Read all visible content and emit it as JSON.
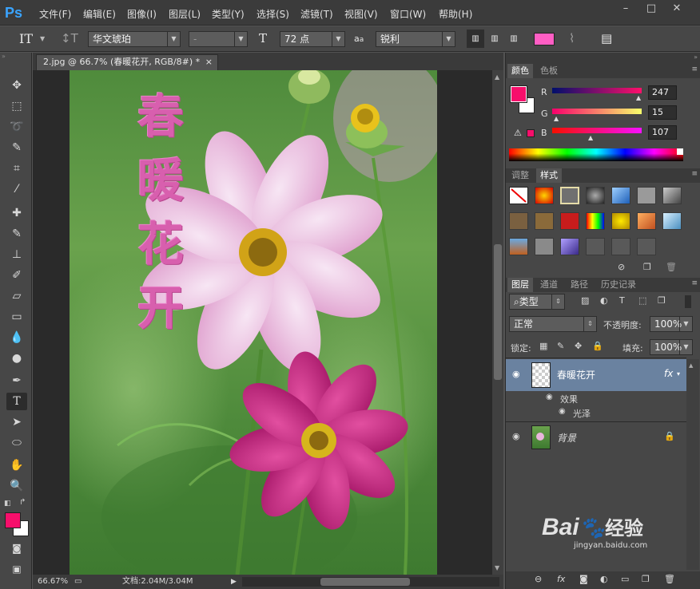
{
  "menubar": {
    "app_logo": "Ps",
    "items": [
      "文件(F)",
      "编辑(E)",
      "图像(I)",
      "图层(L)",
      "类型(Y)",
      "选择(S)",
      "滤镜(T)",
      "视图(V)",
      "窗口(W)",
      "帮助(H)"
    ]
  },
  "options": {
    "tool_glyph": "T",
    "font_family": "华文琥珀",
    "font_style": "-",
    "font_size": "72 点",
    "aa_label": "a",
    "antialias": "锐利",
    "text_color": "#ff5ec4"
  },
  "document": {
    "tab_title": "2.jpg @ 66.7% (春暖花开, RGB/8#) *",
    "close_glyph": "×",
    "text_chars": [
      "春",
      "暖",
      "花",
      "开"
    ],
    "text_color": "#d85fae"
  },
  "status": {
    "zoom": "66.67%",
    "doc_size": "文档:2.04M/3.04M"
  },
  "color_panel": {
    "tabs": [
      "颜色",
      "色板"
    ],
    "channels": [
      {
        "label": "R",
        "value": "247"
      },
      {
        "label": "G",
        "value": "15"
      },
      {
        "label": "B",
        "value": "107"
      }
    ],
    "foreground": "#f70f6b",
    "background": "#ffffff"
  },
  "styles_panel": {
    "tabs": [
      "调整",
      "样式"
    ]
  },
  "layers_panel": {
    "tabs": [
      "图层",
      "通道",
      "路径",
      "历史记录"
    ],
    "filter_kind": "类型",
    "blend_mode": "正常",
    "opacity_label": "不透明度:",
    "opacity": "100%",
    "lock_label": "锁定:",
    "fill_label": "填充:",
    "fill": "100%",
    "layers": [
      {
        "name": "春暖花开",
        "fx": "fx",
        "effects_label": "效果",
        "effect": "光泽"
      },
      {
        "name": "背景"
      }
    ]
  },
  "watermark": {
    "text": "Bai",
    "sub": "经验",
    "url": "jingyan.baidu.com"
  }
}
